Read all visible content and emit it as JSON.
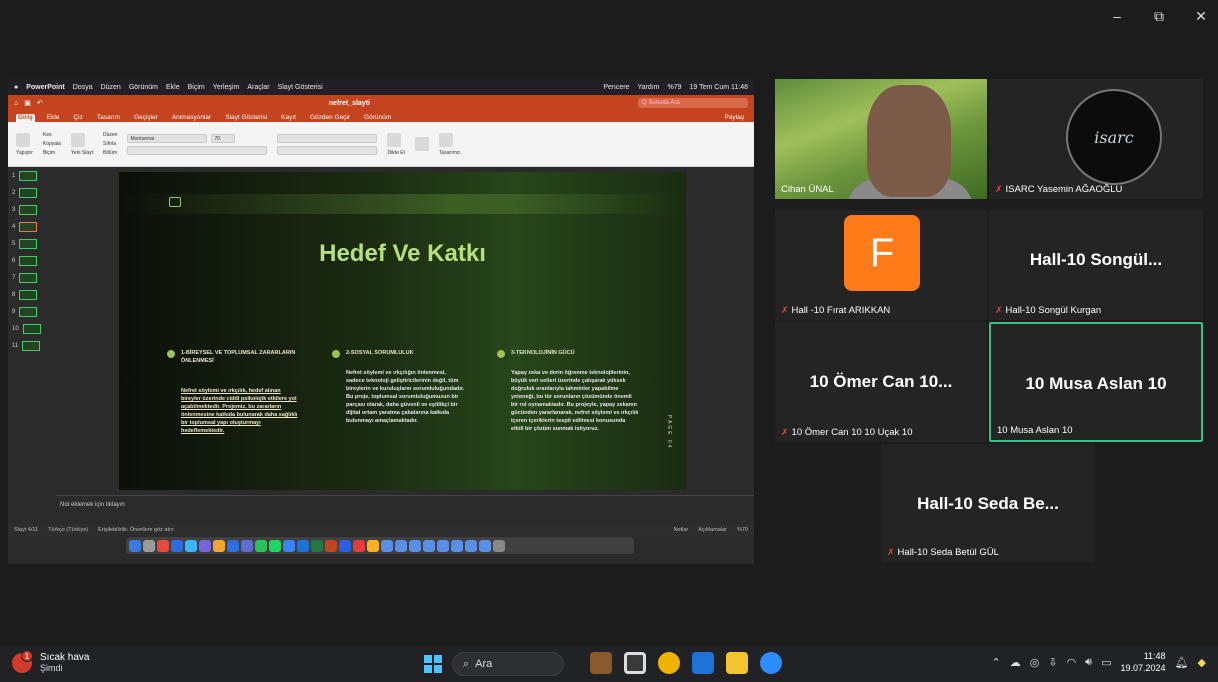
{
  "window": {
    "minimize": "–",
    "restore": "⧉",
    "close": "✕"
  },
  "mac_menubar": {
    "app": "PowerPoint",
    "menus": [
      "Dosya",
      "Düzen",
      "Görünüm",
      "Ekle",
      "Biçim",
      "Yerleşim",
      "Araçlar",
      "Slayt Gösterisi"
    ],
    "right": [
      "Pencere",
      "Yardım",
      "%79",
      "19 Tem Cum 11:48"
    ]
  },
  "ppt": {
    "doc_title": "nefret_slayti",
    "search_placeholder": "Q  Sunuda Ara",
    "tabs": [
      "Giriş",
      "Ekle",
      "Çiz",
      "Tasarım",
      "Geçişler",
      "Animasyonlar",
      "Slayt Gösterisi",
      "Kayıt",
      "Gözden Geçir",
      "Görünüm"
    ],
    "share": "Paylaş",
    "ribbon": {
      "paste": "Yapıştır",
      "cut": "Kes",
      "copy": "Kopyala",
      "format": "Biçim",
      "new_slide": "Yeni Slayt",
      "layout": "Düzen",
      "reset": "Sıfırla",
      "section": "Bölüm",
      "font": "Montserrat",
      "size": "70",
      "dictate": "Dikte Et",
      "designer": "Tasarımcı"
    },
    "thumbs": [
      "1",
      "2",
      "3",
      "4",
      "5",
      "6",
      "7",
      "8",
      "9",
      "10",
      "11"
    ],
    "slide": {
      "title": "Hedef Ve Katkı",
      "col1_head": "1-BİREYSEL VE TOPLUMSAL ZARARLARIN ÖNLENMESİ",
      "col1_body": "Nefret söylemi ve ırkçılık, hedef alınan bireyler üzerinde ciddi psikolojik etkilere yol açabilmektedir. Projemiz, bu zararların önlenmesine katkıda bulunarak daha sağlıklı bir toplumsal yapı oluşturmayı hedeflemektedir.",
      "col2_head": "2-SOSYAL SORUMLULUK",
      "col2_body": "Nefret söylemi ve ırkçılığın önlenmesi, sadece teknoloji geliştiricilerinin değil, tüm bireylerin ve kuruluşların sorumluluğundadır. Bu proje, toplumsal sorumluluğumuzun bir parçası olarak, daha güvenli ve eşitlikçi bir dijital ortam yaratma çabalarına katkıda bulunmayı amaçlamaktadır.",
      "col3_head": "3-TEKNOLOJİNİN GÜCÜ",
      "col3_body": "Yapay zeka ve derin öğrenme teknolojilerinin, büyük veri setleri üzerinde çalışarak yüksek doğruluk oranlarıyla tahminler yapabilme yeteneği, bu tür sorunların çözümünde önemli bir rol oynamaktadır. Bu projeyle, yapay zekanın gücünden yararlanarak, nefret söylemi ve ırkçılık içeren içeriklerin tespit edilmesi konusunda etkili bir çözüm sunmak istiyoruz.",
      "page_label": "PAGE 04"
    },
    "notes_placeholder": "Not eklemek için tıklayın",
    "status": {
      "slide": "Slayt 4/11",
      "lang": "Türkçe (Türkiye)",
      "access": "Erişilebilirlik: Önerilere göz atın",
      "notes": "Notlar",
      "comments": "Açıklamalar",
      "zoom": "%79"
    }
  },
  "participants": [
    {
      "name": "Cihan ÜNAL",
      "type": "video",
      "muted": false
    },
    {
      "name": "ISARC Yasemin AĞAOĞLU",
      "type": "logo",
      "logo_text": "isarc",
      "muted": true
    },
    {
      "name": "Hall -10 Fırat ARIKKAN",
      "type": "avatar",
      "letter": "F",
      "muted": true
    },
    {
      "name": "Hall-10 Songül Kurgan",
      "type": "text",
      "big": "Hall-10  Songül...",
      "muted": true
    },
    {
      "name": "10 Ömer Can 10 10 Uçak 10",
      "type": "text",
      "big": "10 Ömer Can 10...",
      "muted": true
    },
    {
      "name": "10 Musa Aslan 10",
      "type": "text",
      "big": "10 Musa Aslan 10",
      "muted": false,
      "active": true
    },
    {
      "name": "Hall-10 Seda Betül GÜL",
      "type": "text",
      "big": "Hall-10  Seda Be...",
      "muted": true
    }
  ],
  "taskbar": {
    "weather_title": "Sıcak hava",
    "weather_sub": "Şimdi",
    "weather_badge": "1",
    "search": "Ara",
    "time": "11:48",
    "date": "19.07.2024"
  }
}
